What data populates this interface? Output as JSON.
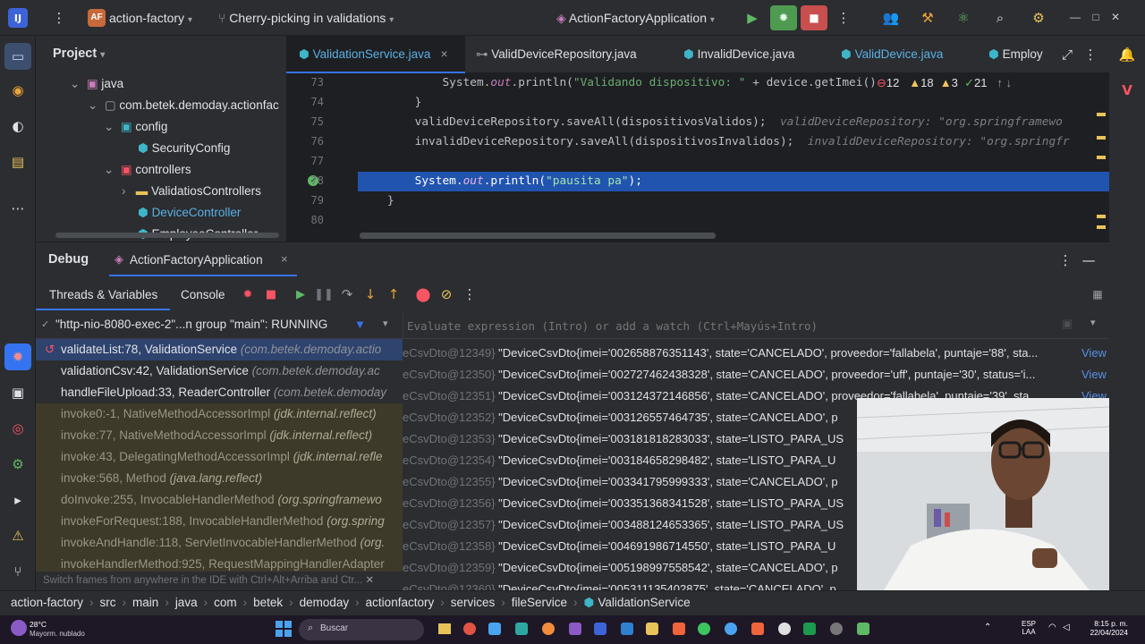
{
  "titlebar": {
    "project_badge": "AF",
    "project_name": "action-factory",
    "branch": "Cherry-picking in validations",
    "run_config": "ActionFactoryApplication",
    "window_controls": [
      "—",
      "□",
      "✕"
    ]
  },
  "project_panel": {
    "title": "Project",
    "tree": [
      {
        "label": "java",
        "icon": "source-folder-icon"
      },
      {
        "label": "com.betek.demoday.actionfac",
        "icon": "package-icon"
      },
      {
        "label": "config",
        "icon": "package-icon"
      },
      {
        "label": "SecurityConfig",
        "icon": "class-icon"
      },
      {
        "label": "controllers",
        "icon": "package-icon"
      },
      {
        "label": "ValidatiosControllers",
        "icon": "folder-icon"
      },
      {
        "label": "DeviceController",
        "icon": "class-icon"
      },
      {
        "label": "EmployeeController",
        "icon": "class-icon"
      }
    ]
  },
  "editor": {
    "tabs": [
      {
        "label": "ValidationService.java",
        "active": true,
        "close": "×"
      },
      {
        "label": "ValidDeviceRepository.java"
      },
      {
        "label": "InvalidDevice.java"
      },
      {
        "label": "ValidDevice.java"
      },
      {
        "label": "Employ"
      }
    ],
    "inspections": {
      "errors": "12",
      "warnings1": "18",
      "warnings2": "3",
      "weak": "21"
    },
    "lines": [
      {
        "num": "73",
        "parts": [
          {
            "t": "            System.",
            "c": "#bcbec4"
          },
          {
            "t": "out",
            "c": "#c77dbb",
            "i": true
          },
          {
            "t": ".println(",
            "c": "#bcbec4"
          },
          {
            "t": "\"Validando dispositivo: \"",
            "c": "#6aab73"
          },
          {
            "t": " + device.getImei() + \"",
            "c": "#bcbec4"
          }
        ]
      },
      {
        "num": "74",
        "parts": [
          {
            "t": "        }",
            "c": "#bcbec4"
          }
        ]
      },
      {
        "num": "75",
        "parts": [
          {
            "t": "        validDeviceRepository.saveAll(dispositivosValidos);",
            "c": "#bcbec4"
          },
          {
            "t": "  validDeviceRepository: \"org.springframewo",
            "c": "#7a7e85",
            "i": true
          }
        ]
      },
      {
        "num": "76",
        "parts": [
          {
            "t": "        invalidDeviceRepository.saveAll(dispositivosInvalidos);",
            "c": "#bcbec4"
          },
          {
            "t": "  invalidDeviceRepository: \"org.springfr",
            "c": "#7a7e85",
            "i": true
          }
        ]
      },
      {
        "num": "77",
        "parts": []
      },
      {
        "num": "78",
        "parts": [
          {
            "t": "        System.",
            "c": "#ffffff"
          },
          {
            "t": "out",
            "c": "#e8b3e0",
            "i": true
          },
          {
            "t": ".println(",
            "c": "#ffffff"
          },
          {
            "t": "\"pausita pa\"",
            "c": "#a5e3ae"
          },
          {
            "t": ");",
            "c": "#ffffff"
          }
        ],
        "highlight": true
      },
      {
        "num": "79",
        "parts": [
          {
            "t": "    }",
            "c": "#bcbec4"
          }
        ]
      },
      {
        "num": "80",
        "parts": []
      }
    ]
  },
  "debug": {
    "title": "Debug",
    "session": "ActionFactoryApplication",
    "tabs": [
      "Threads & Variables",
      "Console"
    ],
    "thread": "\"http-nio-8080-exec-2\"...n group \"main\": RUNNING",
    "evaluate_placeholder": "Evaluate expression (Intro) or add a watch (Ctrl+Mayús+Intro)",
    "frames": [
      {
        "method": "validateList:78, ValidationService",
        "pkg": "(com.betek.demoday.actio",
        "style": "current"
      },
      {
        "method": "validationCsv:42, ValidationService",
        "pkg": "(com.betek.demoday.ac",
        "style": "normal"
      },
      {
        "method": "handleFileUpload:33, ReaderController",
        "pkg": "(com.betek.demoday",
        "style": "normal"
      },
      {
        "method": "invoke0:-1, NativeMethodAccessorImpl",
        "pkg": "(jdk.internal.reflect)",
        "style": "lib"
      },
      {
        "method": "invoke:77, NativeMethodAccessorImpl",
        "pkg": "(jdk.internal.reflect)",
        "style": "lib"
      },
      {
        "method": "invoke:43, DelegatingMethodAccessorImpl",
        "pkg": "(jdk.internal.refle",
        "style": "lib"
      },
      {
        "method": "invoke:568, Method",
        "pkg": "(java.lang.reflect)",
        "style": "lib"
      },
      {
        "method": "doInvoke:255, InvocableHandlerMethod",
        "pkg": "(org.springframewo",
        "style": "lib"
      },
      {
        "method": "invokeForRequest:188, InvocableHandlerMethod",
        "pkg": "(org.spring",
        "style": "lib"
      },
      {
        "method": "invokeAndHandle:118, ServletInvocableHandlerMethod",
        "pkg": "(org.",
        "style": "lib"
      },
      {
        "method": "invokeHandlerMethod:925, RequestMappingHandlerAdapter",
        "pkg": "",
        "style": "lib"
      }
    ],
    "frames_hint": "Switch frames from anywhere in the IDE with Ctrl+Alt+Arriba and Ctr...",
    "variables": [
      {
        "id": "eCsvDto@12349}",
        "value": "\"DeviceCsvDto{imei='002658876351143', state='CANCELADO', proveedor='fallabela', puntaje='88', sta...",
        "link": "View"
      },
      {
        "id": "eCsvDto@12350}",
        "value": "\"DeviceCsvDto{imei='002727462438328', state='CANCELADO', proveedor='uff', puntaje='30', status='i...",
        "link": "View"
      },
      {
        "id": "eCsvDto@12351}",
        "value": "\"DeviceCsvDto{imei='003124372146856', state='CANCELADO', proveedor='fallabela', puntaje='39', sta...",
        "link": "View"
      },
      {
        "id": "eCsvDto@12352}",
        "value": "\"DeviceCsvDto{imei='003126557464735', state='CANCELADO', p",
        "link": ""
      },
      {
        "id": "eCsvDto@12353}",
        "value": "\"DeviceCsvDto{imei='003181818283033', state='LISTO_PARA_US",
        "link": ""
      },
      {
        "id": "eCsvDto@12354}",
        "value": "\"DeviceCsvDto{imei='003184658298482', state='LISTO_PARA_U",
        "link": ""
      },
      {
        "id": "eCsvDto@12355}",
        "value": "\"DeviceCsvDto{imei='003341795999333', state='CANCELADO', p",
        "link": ""
      },
      {
        "id": "eCsvDto@12356}",
        "value": "\"DeviceCsvDto{imei='003351368341528', state='LISTO_PARA_US",
        "link": ""
      },
      {
        "id": "eCsvDto@12357}",
        "value": "\"DeviceCsvDto{imei='003488124653365', state='LISTO_PARA_US",
        "link": ""
      },
      {
        "id": "eCsvDto@12358}",
        "value": "\"DeviceCsvDto{imei='004691986714550', state='LISTO_PARA_U",
        "link": ""
      },
      {
        "id": "eCsvDto@12359}",
        "value": "\"DeviceCsvDto{imei='005198997558542', state='CANCELADO', p",
        "link": ""
      },
      {
        "id": "eCsvDto@12360}",
        "value": "\"DeviceCsvDto{imei='005311135402875', state='CANCELADO', p",
        "link": ""
      }
    ]
  },
  "breadcrumb": [
    "action-factory",
    "src",
    "main",
    "java",
    "com",
    "betek",
    "demoday",
    "actionfactory",
    "services",
    "fileService",
    "ValidationService"
  ],
  "taskbar": {
    "weather_temp": "28°C",
    "weather_desc": "Mayorm. nublado",
    "search": "Buscar",
    "lang1": "ESP",
    "lang2": "LAA",
    "time": "8:15 p. m.",
    "date": "22/04/2024"
  },
  "colors": {
    "accent": "#3574f0",
    "highlight_line": "#2154ae",
    "error": "#f75464",
    "warning": "#f2c55c",
    "run": "#5fb865"
  }
}
